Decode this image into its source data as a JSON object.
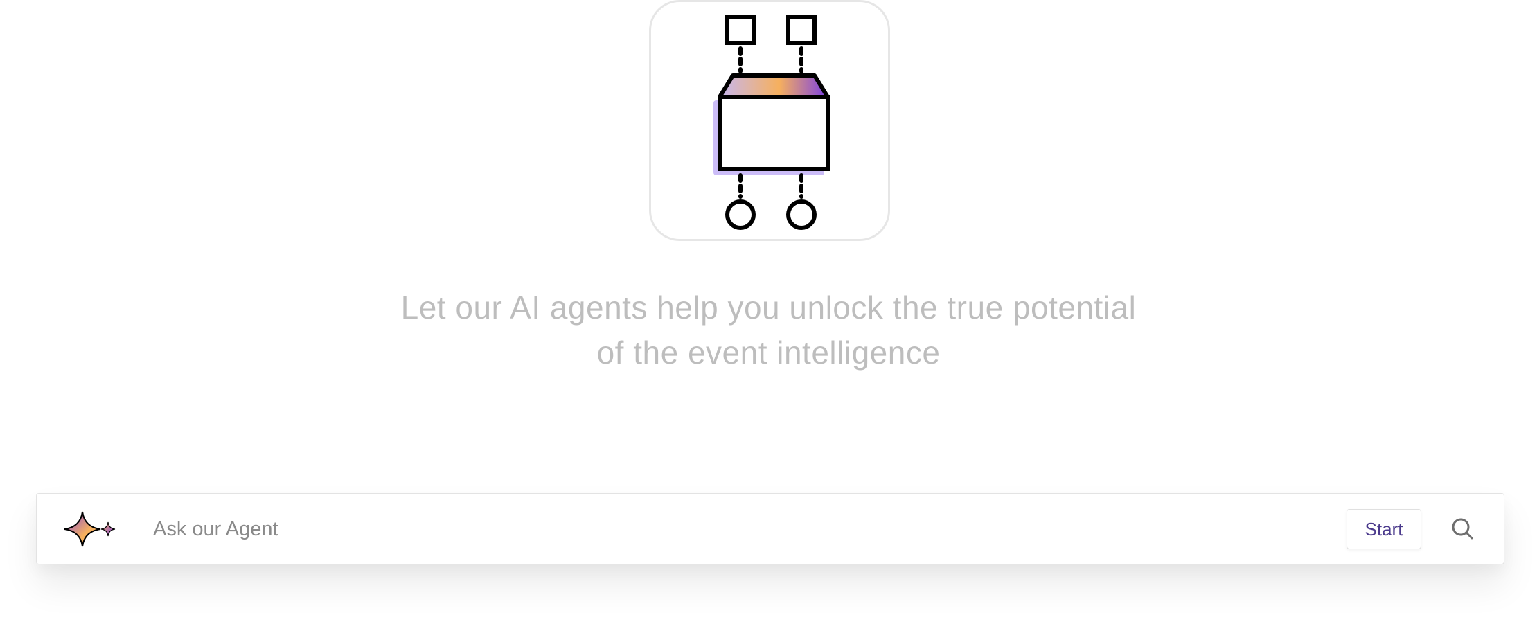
{
  "hero": {
    "illustration_icon": "agent-circuit-box-icon",
    "accent_colors": [
      "#a98bf5",
      "#f6b05e",
      "#7b3fe4"
    ]
  },
  "tagline": {
    "line1": "Let our AI agents help you unlock the true potential",
    "line2": "of the event intelligence"
  },
  "agent_bar": {
    "logo_icon": "sparkle-icon",
    "input_placeholder": "Ask our Agent",
    "input_value": "",
    "start_label": "Start",
    "search_icon": "search-icon",
    "start_label_color": "#4b3a8c"
  }
}
